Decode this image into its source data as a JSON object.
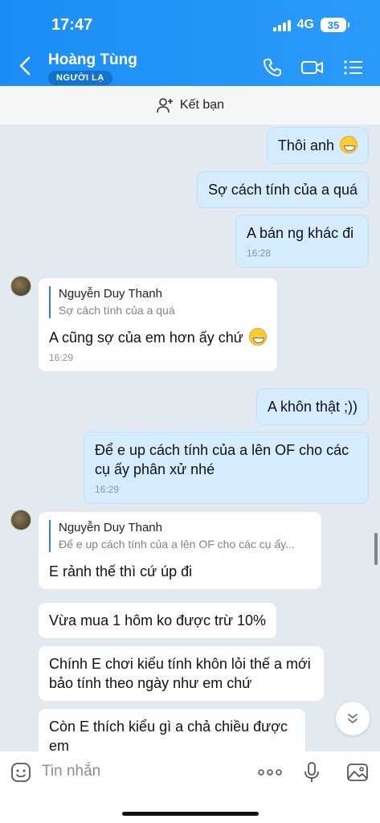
{
  "status": {
    "time": "17:47",
    "network": "4G",
    "battery": "35"
  },
  "header": {
    "title": "Hoàng Tùng",
    "badge": "NGƯỜI LẠ"
  },
  "friend_bar": {
    "label": "Kết bạn"
  },
  "messages": [
    {
      "text": "Thôi anh"
    },
    {
      "text": "Sợ cách tính của a quá"
    },
    {
      "text": "A bán ng khác đi",
      "time": "16:28"
    },
    {
      "quote_name": "Nguyễn Duy Thanh",
      "quote_text": "Sợ cách tính của a quá",
      "text": "A cũng sợ của em hơn ấy chứ",
      "time": "16:29"
    },
    {
      "text": "A khôn thật ;))"
    },
    {
      "text": "Để e up cách tính của a lên OF cho các cụ ấy phân xử nhé",
      "time": "16:29"
    },
    {
      "quote_name": "Nguyễn Duy Thanh",
      "quote_text": "Để e up cách tính của a lên OF cho các cụ ấy...",
      "text": "E rảnh thế thì cứ úp đi"
    },
    {
      "text": "Vừa mua 1 hôm ko được trừ 10%"
    },
    {
      "text": "Chính E chơi kiểu tính khôn lỏi thế a mới bảo tính theo ngày như em chứ"
    },
    {
      "text": "Còn E  thích kiểu gì a chả chiều được em"
    }
  ],
  "input": {
    "placeholder": "Tin nhắn"
  },
  "colors": {
    "header": "#1b8df7",
    "my_bubble": "#d5ecff",
    "their_bubble": "#ffffff",
    "chat_bg": "#e2e9f1"
  }
}
